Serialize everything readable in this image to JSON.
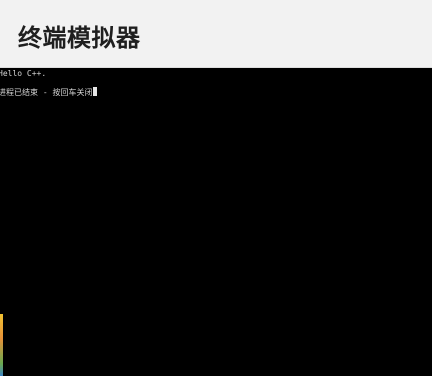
{
  "app": {
    "title": "终端模拟器"
  },
  "terminal": {
    "lines": [
      "Hello C++.",
      "进程已结束 - 按回车关闭"
    ]
  },
  "colors": {
    "title_bar_bg": "#f2f2f2",
    "title_text": "#1f1f1f",
    "terminal_bg": "#000000",
    "terminal_text": "#d6d6d6"
  },
  "icons": {
    "cursor": "block-cursor"
  }
}
